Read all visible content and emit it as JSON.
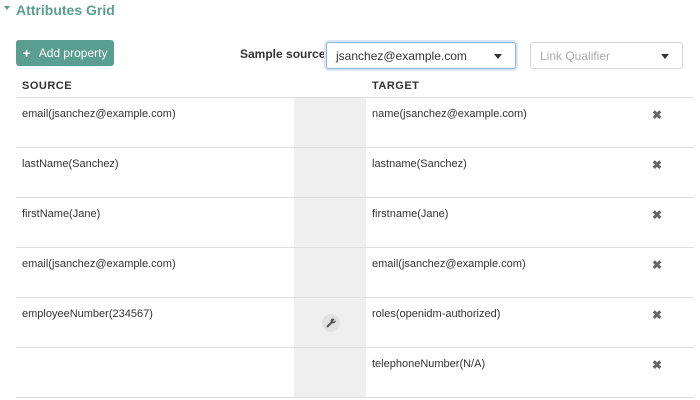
{
  "section": {
    "title": "Attributes Grid"
  },
  "toolbar": {
    "add_label": "Add property",
    "sample_source_label": "Sample source.:",
    "sample_source_value": "jsanchez@example.com",
    "link_qualifier_placeholder": "Link Qualifier"
  },
  "grid": {
    "headers": {
      "source": "SOURCE",
      "target": "TARGET"
    },
    "rows": [
      {
        "source": "email(jsanchez@example.com)",
        "target": "name(jsanchez@example.com)"
      },
      {
        "source": "lastName(Sanchez)",
        "target": "lastname(Sanchez)"
      },
      {
        "source": "firstName(Jane)",
        "target": "firstname(Jane)"
      },
      {
        "source": "email(jsanchez@example.com)",
        "target": "email(jsanchez@example.com)"
      },
      {
        "source": "employeeNumber(234567)",
        "target": "roles(openidm-authorized)"
      },
      {
        "source": "",
        "target": "telephoneNumber(N/A)"
      }
    ]
  },
  "icons": {
    "remove": "close-icon",
    "transform": "wrench-icon",
    "add": "plus-icon",
    "collapse": "caret-down-icon"
  }
}
